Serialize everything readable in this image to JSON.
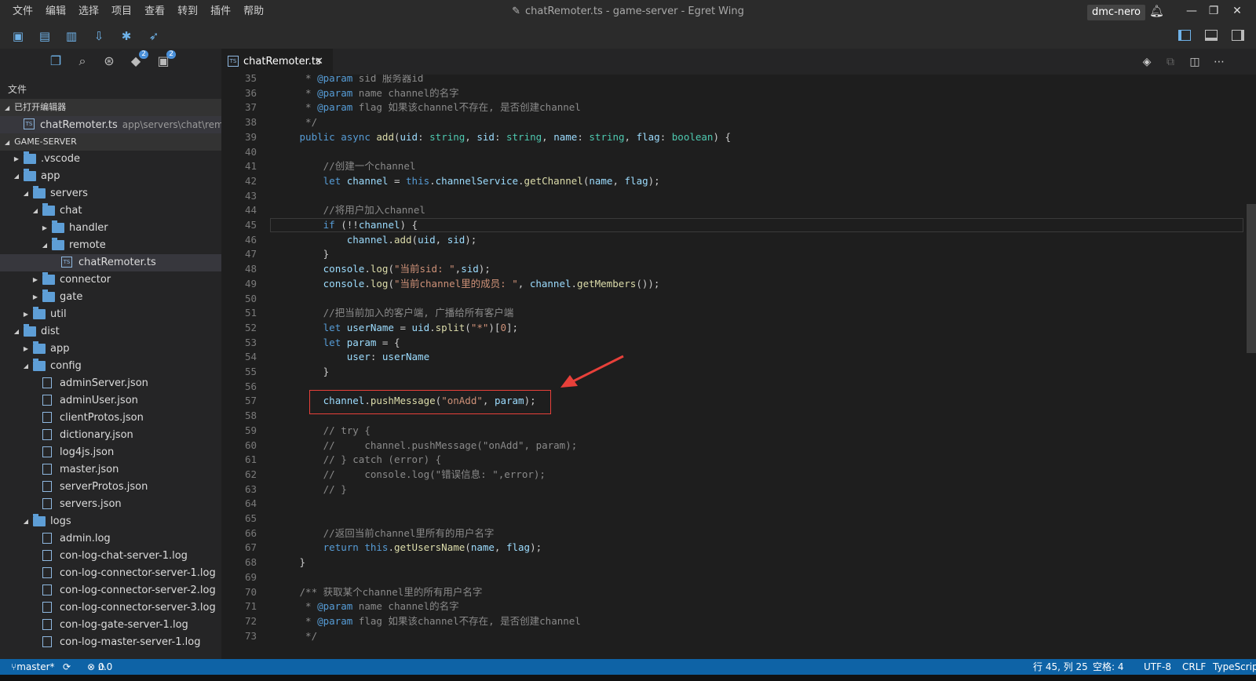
{
  "menu": [
    "文件",
    "编辑",
    "选择",
    "项目",
    "查看",
    "转到",
    "插件",
    "帮助"
  ],
  "window_title": "chatRemoter.ts - game-server - Egret Wing",
  "user": "dmc-nero",
  "sidebar": {
    "section_title": "文件",
    "open_editors_label": "已打开编辑器",
    "open_editor_file": "chatRemoter.ts",
    "open_editor_path": "app\\servers\\chat\\remote",
    "project_label": "GAME-SERVER",
    "tree": [
      {
        "label": ".vscode",
        "depth": 1,
        "kind": "folder",
        "expanded": false
      },
      {
        "label": "app",
        "depth": 1,
        "kind": "folder",
        "expanded": true
      },
      {
        "label": "servers",
        "depth": 2,
        "kind": "folder",
        "expanded": true
      },
      {
        "label": "chat",
        "depth": 3,
        "kind": "folder",
        "expanded": true
      },
      {
        "label": "handler",
        "depth": 4,
        "kind": "folder",
        "expanded": false
      },
      {
        "label": "remote",
        "depth": 4,
        "kind": "folder",
        "expanded": true
      },
      {
        "label": "chatRemoter.ts",
        "depth": 5,
        "kind": "ts",
        "selected": true
      },
      {
        "label": "connector",
        "depth": 3,
        "kind": "folder",
        "expanded": false
      },
      {
        "label": "gate",
        "depth": 3,
        "kind": "folder",
        "expanded": false
      },
      {
        "label": "util",
        "depth": 2,
        "kind": "folder",
        "expanded": false
      },
      {
        "label": "dist",
        "depth": 1,
        "kind": "folder",
        "expanded": true
      },
      {
        "label": "app",
        "depth": 2,
        "kind": "folder",
        "expanded": false
      },
      {
        "label": "config",
        "depth": 2,
        "kind": "folder",
        "expanded": true
      },
      {
        "label": "adminServer.json",
        "depth": 3,
        "kind": "json"
      },
      {
        "label": "adminUser.json",
        "depth": 3,
        "kind": "json"
      },
      {
        "label": "clientProtos.json",
        "depth": 3,
        "kind": "json"
      },
      {
        "label": "dictionary.json",
        "depth": 3,
        "kind": "json"
      },
      {
        "label": "log4js.json",
        "depth": 3,
        "kind": "json"
      },
      {
        "label": "master.json",
        "depth": 3,
        "kind": "json"
      },
      {
        "label": "serverProtos.json",
        "depth": 3,
        "kind": "json"
      },
      {
        "label": "servers.json",
        "depth": 3,
        "kind": "json"
      },
      {
        "label": "logs",
        "depth": 2,
        "kind": "folder",
        "expanded": true
      },
      {
        "label": "admin.log",
        "depth": 3,
        "kind": "file"
      },
      {
        "label": "con-log-chat-server-1.log",
        "depth": 3,
        "kind": "file"
      },
      {
        "label": "con-log-connector-server-1.log",
        "depth": 3,
        "kind": "file"
      },
      {
        "label": "con-log-connector-server-2.log",
        "depth": 3,
        "kind": "file"
      },
      {
        "label": "con-log-connector-server-3.log",
        "depth": 3,
        "kind": "file"
      },
      {
        "label": "con-log-gate-server-1.log",
        "depth": 3,
        "kind": "file"
      },
      {
        "label": "con-log-master-server-1.log",
        "depth": 3,
        "kind": "file"
      }
    ],
    "badges": {
      "git": "2",
      "extensions": "2"
    }
  },
  "tab": {
    "name": "chatRemoter.ts",
    "close": "✕"
  },
  "code_lines": [
    {
      "n": "35",
      "html": "<span class='c'>  * </span><span class='tag'>@param</span><span class='c'> sid 服务器id</span>"
    },
    {
      "n": "36",
      "html": "<span class='c'>  * </span><span class='tag'>@param</span><span class='c'> name channel的名字</span>"
    },
    {
      "n": "37",
      "html": "<span class='c'>  * </span><span class='tag'>@param</span><span class='c'> flag 如果该channel不存在, 是否创建channel</span>"
    },
    {
      "n": "38",
      "html": "<span class='c'>  */</span>"
    },
    {
      "n": "39",
      "html": " <span class='k'>public</span> <span class='k'>async</span> <span class='f'>add</span>(<span class='v'>uid</span>: <span class='t'>string</span>, <span class='v'>sid</span>: <span class='t'>string</span>, <span class='v'>name</span>: <span class='t'>string</span>, <span class='v'>flag</span>: <span class='t'>boolean</span>) {"
    },
    {
      "n": "40",
      "html": ""
    },
    {
      "n": "41",
      "html": "     <span class='c'>//创建一个channel</span>"
    },
    {
      "n": "42",
      "html": "     <span class='k'>let</span> <span class='v'>channel</span> = <span class='k'>this</span>.<span class='v'>channelService</span>.<span class='f'>getChannel</span>(<span class='v'>name</span>, <span class='v'>flag</span>);"
    },
    {
      "n": "43",
      "html": ""
    },
    {
      "n": "44",
      "html": "     <span class='c'>//将用户加入channel</span>"
    },
    {
      "n": "45",
      "html": "     <span class='k'>if</span> (!!<span class='v'>channel</span>) {"
    },
    {
      "n": "46",
      "html": "         <span class='v'>channel</span>.<span class='f'>add</span>(<span class='v'>uid</span>, <span class='v'>sid</span>);"
    },
    {
      "n": "47",
      "html": "     }"
    },
    {
      "n": "48",
      "html": "     <span class='v'>console</span>.<span class='f'>log</span>(<span class='s'>\"当前sid: \"</span>,<span class='v'>sid</span>);"
    },
    {
      "n": "49",
      "html": "     <span class='v'>console</span>.<span class='f'>log</span>(<span class='s'>\"当前channel里的成员: \"</span>, <span class='v'>channel</span>.<span class='f'>getMembers</span>());"
    },
    {
      "n": "50",
      "html": ""
    },
    {
      "n": "51",
      "html": "     <span class='c'>//把当前加入的客户端, 广播给所有客户端</span>"
    },
    {
      "n": "52",
      "html": "     <span class='k'>let</span> <span class='v'>userName</span> = <span class='v'>uid</span>.<span class='f'>split</span>(<span class='s'>\"*\"</span>)[<span class='s'>0</span>];"
    },
    {
      "n": "53",
      "html": "     <span class='k'>let</span> <span class='v'>param</span> = {"
    },
    {
      "n": "54",
      "html": "         <span class='v'>user</span>: <span class='v'>userName</span>"
    },
    {
      "n": "55",
      "html": "     }"
    },
    {
      "n": "56",
      "html": ""
    },
    {
      "n": "57",
      "html": "     <span class='v'>channel</span>.<span class='f'>pushMessage</span>(<span class='s'>\"onAdd\"</span>, <span class='v'>param</span>);"
    },
    {
      "n": "58",
      "html": ""
    },
    {
      "n": "59",
      "html": "     <span class='c'>// try {</span>"
    },
    {
      "n": "60",
      "html": "     <span class='c'>//     channel.pushMessage(\"onAdd\", param);</span>"
    },
    {
      "n": "61",
      "html": "     <span class='c'>// } catch (error) {</span>"
    },
    {
      "n": "62",
      "html": "     <span class='c'>//     console.log(\"错误信息: \",error);</span>"
    },
    {
      "n": "63",
      "html": "     <span class='c'>// }</span>"
    },
    {
      "n": "64",
      "html": ""
    },
    {
      "n": "65",
      "html": ""
    },
    {
      "n": "66",
      "html": "     <span class='c'>//返回当前channel里所有的用户名字</span>"
    },
    {
      "n": "67",
      "html": "     <span class='k'>return</span> <span class='k'>this</span>.<span class='f'>getUsersName</span>(<span class='v'>name</span>, <span class='v'>flag</span>);"
    },
    {
      "n": "68",
      "html": " }"
    },
    {
      "n": "69",
      "html": ""
    },
    {
      "n": "70",
      "html": " <span class='c'>/** 获取某个channel里的所有用户名字</span>"
    },
    {
      "n": "71",
      "html": "<span class='c'>  * </span><span class='tag'>@param</span><span class='c'> name channel的名字</span>"
    },
    {
      "n": "72",
      "html": "<span class='c'>  * </span><span class='tag'>@param</span><span class='c'> flag 如果该channel不存在, 是否创建channel</span>"
    },
    {
      "n": "73",
      "html": "<span class='c'>  */</span>"
    }
  ],
  "status": {
    "branch": "master*",
    "errors": "0",
    "warnings": "0",
    "position": "行 45, 列 25",
    "spaces": "空格: 4",
    "encoding": "UTF-8",
    "eol": "CRLF",
    "language": "TypeScript"
  },
  "colors": {
    "accent": "#0e63a6",
    "highlight_box": "#e8403a",
    "arrow": "#e8403a"
  }
}
